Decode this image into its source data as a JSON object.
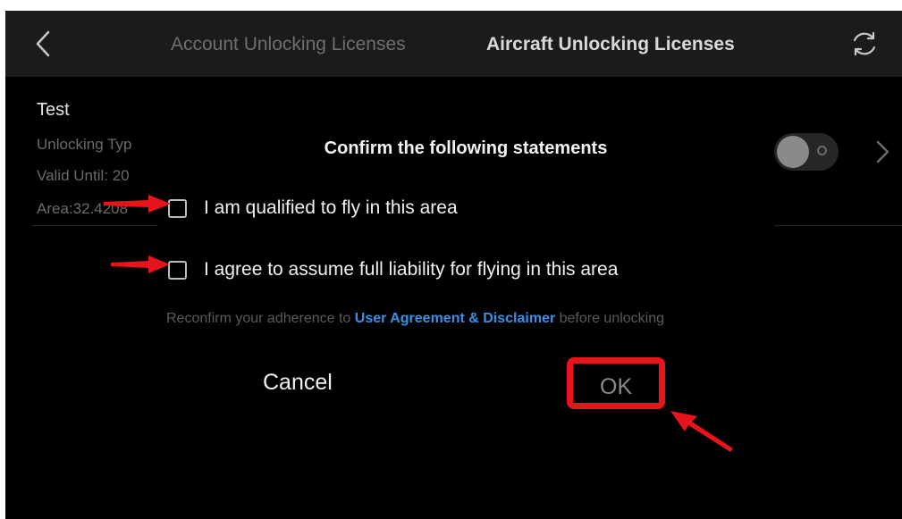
{
  "header": {
    "tabs": [
      {
        "label": "Account Unlocking Licenses",
        "active": false
      },
      {
        "label": "Aircraft Unlocking Licenses",
        "active": true
      }
    ],
    "back_icon": "chevron-left-icon",
    "refresh_icon": "refresh-icon"
  },
  "license": {
    "title": "Test",
    "type_line": "Unlocking Typ",
    "valid_line": "Valid Until:  20",
    "area_line": "Area:32.4208",
    "toggle_on": false
  },
  "dialog": {
    "title": "Confirm the following statements",
    "statements": [
      {
        "label": "I am qualified to fly in this area",
        "checked": false
      },
      {
        "label": "I agree to assume full liability for flying in this area",
        "checked": false
      }
    ],
    "reconfirm_prefix": "Reconfirm your adherence to ",
    "reconfirm_link": "User Agreement & Disclaimer",
    "reconfirm_suffix": " before unlocking",
    "cancel_label": "Cancel",
    "ok_label": "OK"
  },
  "colors": {
    "background": "#000000",
    "header": "#1b1b1b",
    "link": "#3b8fe8",
    "annotation": "#e8141b"
  }
}
